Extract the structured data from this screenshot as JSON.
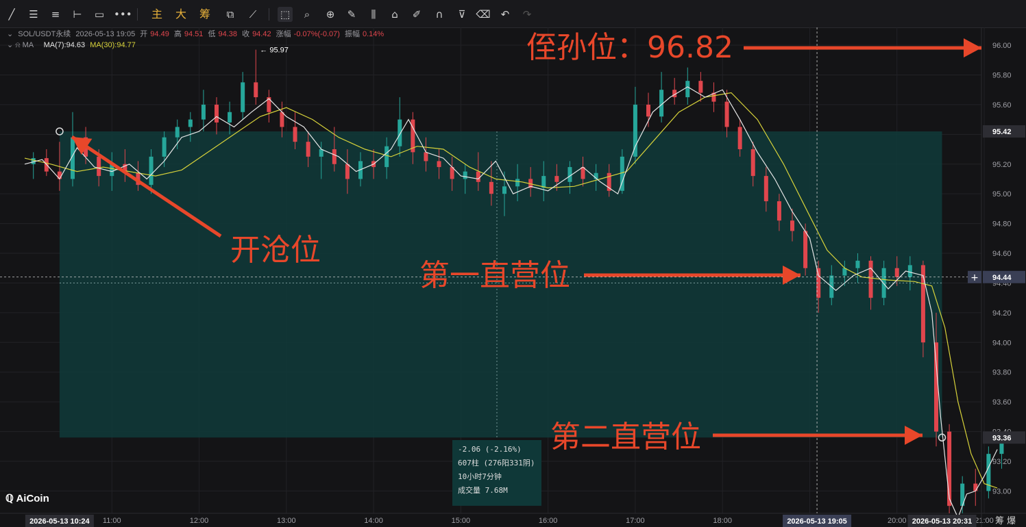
{
  "toolbar": {
    "icons": [
      "line-tool-icon",
      "horizontal-lines-icon",
      "parallel-lines-icon",
      "horizontal-ray-icon",
      "rectangle-icon",
      "more-shapes-icon"
    ],
    "labels": [
      "主",
      "大",
      "筹"
    ],
    "tools": [
      "crop-icon",
      "measure-icon",
      "zoom-icon",
      "brush-icon",
      "candle-icon",
      "lock-icon",
      "edit-icon",
      "magnet-icon",
      "filter-icon",
      "trash-icon",
      "undo-icon",
      "redo-icon"
    ]
  },
  "info": {
    "symbol": "SOL/USDT永续",
    "datetime": "2026-05-13 19:05",
    "open_label": "开",
    "open": "94.49",
    "high_label": "高",
    "high": "94.51",
    "low_label": "低",
    "low": "94.38",
    "close_label": "收",
    "close": "94.42",
    "change_label": "涨幅",
    "change": "-0.07%(-0.07)",
    "amp_label": "振幅",
    "amp": "0.14%"
  },
  "ma": {
    "name": "MA",
    "ma7": "MA(7):94.63",
    "ma30": "MA(30):94.77"
  },
  "tooltip": {
    "line1": "-2.06 (-2.16%)",
    "line2": "607柱 (276阳331阴)",
    "line3": "10小时7分钟",
    "line4": "成交量 7.68M"
  },
  "logo": "AiCoin",
  "bottom_right": "筹 爆",
  "colors": {
    "up": "#26a69a",
    "down": "#e0464d",
    "ma7": "#e6e6e6",
    "ma30": "#d7d23a",
    "zone": "#0f3a3a",
    "annotation": "#e8472a"
  },
  "chart_data": {
    "type": "candlestick",
    "y_ticks": [
      "96.00",
      "95.80",
      "95.60",
      "95.40",
      "95.20",
      "95.00",
      "94.80",
      "94.60",
      "94.40",
      "94.20",
      "94.00",
      "93.80",
      "93.60",
      "93.40",
      "93.20",
      "93.00"
    ],
    "x_ticks": [
      "11:00",
      "12:00",
      "13:00",
      "14:00",
      "15:00",
      "16:00",
      "17:00",
      "18:00",
      "19:00",
      "20:00",
      "21:00"
    ],
    "ylim": [
      92.85,
      96.12
    ],
    "xlim": [
      "10:00",
      "21:00"
    ],
    "price_badges": [
      "95.42",
      "94.44",
      "93.36"
    ],
    "x_badges": [
      "2026-05-13 10:24",
      "2026-05-13 19:05",
      "2026-05-13 20:31"
    ],
    "high_marker": "← 95.97",
    "zone": {
      "x_start": "10:24",
      "x_end": "20:31",
      "y_top": 95.42,
      "y_bottom": 93.36
    },
    "ma7_points": [
      [
        10.0,
        95.2
      ],
      [
        10.2,
        95.23
      ],
      [
        10.4,
        95.1
      ],
      [
        10.6,
        95.31
      ],
      [
        10.8,
        95.18
      ],
      [
        11.0,
        95.15
      ],
      [
        11.2,
        95.2
      ],
      [
        11.4,
        95.1
      ],
      [
        11.6,
        95.22
      ],
      [
        11.8,
        95.38
      ],
      [
        12.0,
        95.42
      ],
      [
        12.2,
        95.52
      ],
      [
        12.4,
        95.45
      ],
      [
        12.6,
        95.55
      ],
      [
        12.8,
        95.64
      ],
      [
        13.0,
        95.52
      ],
      [
        13.2,
        95.45
      ],
      [
        13.4,
        95.3
      ],
      [
        13.6,
        95.25
      ],
      [
        13.8,
        95.15
      ],
      [
        14.0,
        95.2
      ],
      [
        14.2,
        95.3
      ],
      [
        14.4,
        95.5
      ],
      [
        14.6,
        95.28
      ],
      [
        14.8,
        95.24
      ],
      [
        15.0,
        95.12
      ],
      [
        15.2,
        95.1
      ],
      [
        15.4,
        95.22
      ],
      [
        15.6,
        95.0
      ],
      [
        15.8,
        95.05
      ],
      [
        16.0,
        95.02
      ],
      [
        16.2,
        95.1
      ],
      [
        16.4,
        95.18
      ],
      [
        16.6,
        95.08
      ],
      [
        16.8,
        95.0
      ],
      [
        17.0,
        95.32
      ],
      [
        17.2,
        95.55
      ],
      [
        17.4,
        95.65
      ],
      [
        17.6,
        95.72
      ],
      [
        17.8,
        95.65
      ],
      [
        18.0,
        95.7
      ],
      [
        18.2,
        95.5
      ],
      [
        18.4,
        95.28
      ],
      [
        18.6,
        95.1
      ],
      [
        18.8,
        94.88
      ],
      [
        19.0,
        94.7
      ],
      [
        19.1,
        94.45
      ],
      [
        19.3,
        94.35
      ],
      [
        19.5,
        94.45
      ],
      [
        19.7,
        94.5
      ],
      [
        19.9,
        94.36
      ],
      [
        20.1,
        94.48
      ],
      [
        20.3,
        94.45
      ],
      [
        20.4,
        94.2
      ],
      [
        20.5,
        93.5
      ],
      [
        20.6,
        92.95
      ],
      [
        20.7,
        92.82
      ],
      [
        20.8,
        92.98
      ],
      [
        20.9,
        93.0
      ],
      [
        21.0,
        93.1
      ],
      [
        21.15,
        93.28
      ]
    ],
    "ma30_points": [
      [
        10.0,
        95.24
      ],
      [
        10.3,
        95.2
      ],
      [
        10.6,
        95.15
      ],
      [
        10.9,
        95.18
      ],
      [
        11.2,
        95.15
      ],
      [
        11.5,
        95.12
      ],
      [
        11.8,
        95.16
      ],
      [
        12.1,
        95.28
      ],
      [
        12.4,
        95.4
      ],
      [
        12.7,
        95.52
      ],
      [
        13.0,
        95.58
      ],
      [
        13.3,
        95.5
      ],
      [
        13.6,
        95.38
      ],
      [
        13.9,
        95.3
      ],
      [
        14.2,
        95.25
      ],
      [
        14.5,
        95.32
      ],
      [
        14.8,
        95.3
      ],
      [
        15.1,
        95.18
      ],
      [
        15.4,
        95.1
      ],
      [
        15.7,
        95.08
      ],
      [
        16.0,
        95.04
      ],
      [
        16.3,
        95.05
      ],
      [
        16.6,
        95.1
      ],
      [
        16.9,
        95.15
      ],
      [
        17.2,
        95.35
      ],
      [
        17.5,
        95.55
      ],
      [
        17.8,
        95.65
      ],
      [
        18.1,
        95.68
      ],
      [
        18.4,
        95.5
      ],
      [
        18.7,
        95.2
      ],
      [
        19.0,
        94.85
      ],
      [
        19.2,
        94.62
      ],
      [
        19.4,
        94.5
      ],
      [
        19.6,
        94.44
      ],
      [
        19.9,
        94.42
      ],
      [
        20.2,
        94.41
      ],
      [
        20.4,
        94.38
      ],
      [
        20.55,
        94.1
      ],
      [
        20.7,
        93.6
      ],
      [
        20.85,
        93.25
      ],
      [
        21.0,
        93.05
      ],
      [
        21.15,
        93.02
      ]
    ],
    "candles": [
      [
        10.1,
        95.2,
        95.28,
        95.1,
        95.24
      ],
      [
        10.25,
        95.24,
        95.3,
        95.12,
        95.15
      ],
      [
        10.4,
        95.15,
        95.35,
        95.02,
        95.1
      ],
      [
        10.55,
        95.1,
        95.55,
        95.05,
        95.38
      ],
      [
        10.7,
        95.38,
        95.45,
        95.2,
        95.25
      ],
      [
        10.85,
        95.25,
        95.3,
        95.05,
        95.12
      ],
      [
        11.0,
        95.12,
        95.28,
        95.02,
        95.2
      ],
      [
        11.15,
        95.2,
        95.3,
        95.08,
        95.14
      ],
      [
        11.3,
        95.14,
        95.22,
        95.02,
        95.06
      ],
      [
        11.45,
        95.06,
        95.3,
        95.0,
        95.25
      ],
      [
        11.6,
        95.25,
        95.42,
        95.18,
        95.38
      ],
      [
        11.75,
        95.38,
        95.5,
        95.3,
        95.45
      ],
      [
        11.9,
        95.45,
        95.55,
        95.35,
        95.5
      ],
      [
        12.05,
        95.5,
        95.7,
        95.42,
        95.6
      ],
      [
        12.2,
        95.6,
        95.65,
        95.4,
        95.48
      ],
      [
        12.35,
        95.48,
        95.62,
        95.4,
        95.55
      ],
      [
        12.5,
        95.55,
        95.82,
        95.5,
        95.75
      ],
      [
        12.65,
        95.75,
        95.97,
        95.6,
        95.65
      ],
      [
        12.8,
        95.65,
        95.7,
        95.48,
        95.55
      ],
      [
        12.95,
        95.55,
        95.62,
        95.38,
        95.45
      ],
      [
        13.1,
        95.45,
        95.55,
        95.3,
        95.35
      ],
      [
        13.25,
        95.35,
        95.42,
        95.18,
        95.25
      ],
      [
        13.4,
        95.25,
        95.35,
        95.1,
        95.3
      ],
      [
        13.55,
        95.3,
        95.45,
        95.15,
        95.2
      ],
      [
        13.7,
        95.2,
        95.3,
        95.0,
        95.1
      ],
      [
        13.85,
        95.1,
        95.28,
        95.05,
        95.22
      ],
      [
        14.0,
        95.22,
        95.3,
        95.1,
        95.18
      ],
      [
        14.15,
        95.18,
        95.38,
        95.1,
        95.32
      ],
      [
        14.3,
        95.32,
        95.65,
        95.25,
        95.5
      ],
      [
        14.45,
        95.5,
        95.55,
        95.2,
        95.28
      ],
      [
        14.6,
        95.28,
        95.38,
        95.15,
        95.22
      ],
      [
        14.75,
        95.22,
        95.3,
        95.1,
        95.18
      ],
      [
        14.9,
        95.18,
        95.25,
        95.02,
        95.1
      ],
      [
        15.05,
        95.1,
        95.2,
        95.0,
        95.15
      ],
      [
        15.2,
        95.15,
        95.28,
        95.02,
        95.08
      ],
      [
        15.35,
        95.08,
        95.22,
        94.92,
        95.0
      ],
      [
        15.5,
        95.0,
        95.15,
        94.85,
        95.05
      ],
      [
        15.65,
        95.05,
        95.2,
        94.95,
        95.1
      ],
      [
        15.8,
        95.1,
        95.18,
        94.98,
        95.04
      ],
      [
        15.95,
        95.04,
        95.22,
        94.95,
        95.12
      ],
      [
        16.1,
        95.12,
        95.2,
        95.02,
        95.08
      ],
      [
        16.25,
        95.08,
        95.22,
        95.0,
        95.18
      ],
      [
        16.4,
        95.18,
        95.25,
        95.05,
        95.1
      ],
      [
        16.55,
        95.1,
        95.2,
        95.02,
        95.14
      ],
      [
        16.7,
        95.14,
        95.2,
        94.98,
        95.02
      ],
      [
        16.85,
        95.02,
        95.3,
        95.0,
        95.25
      ],
      [
        17.0,
        95.25,
        95.72,
        95.2,
        95.6
      ],
      [
        17.15,
        95.6,
        95.68,
        95.45,
        95.52
      ],
      [
        17.3,
        95.52,
        95.82,
        95.48,
        95.7
      ],
      [
        17.45,
        95.7,
        95.78,
        95.6,
        95.65
      ],
      [
        17.6,
        95.65,
        95.85,
        95.6,
        95.76
      ],
      [
        17.75,
        95.76,
        95.82,
        95.62,
        95.68
      ],
      [
        17.9,
        95.68,
        95.75,
        95.55,
        95.62
      ],
      [
        18.05,
        95.62,
        95.7,
        95.38,
        95.45
      ],
      [
        18.2,
        95.45,
        95.5,
        95.25,
        95.3
      ],
      [
        18.35,
        95.3,
        95.35,
        95.05,
        95.12
      ],
      [
        18.5,
        95.12,
        95.18,
        94.88,
        94.95
      ],
      [
        18.65,
        94.95,
        95.0,
        94.75,
        94.82
      ],
      [
        18.8,
        94.82,
        94.9,
        94.68,
        94.75
      ],
      [
        18.95,
        94.75,
        94.8,
        94.45,
        94.5
      ],
      [
        19.1,
        94.5,
        94.55,
        94.2,
        94.3
      ],
      [
        19.25,
        94.3,
        94.52,
        94.25,
        94.45
      ],
      [
        19.4,
        94.45,
        94.55,
        94.38,
        94.5
      ],
      [
        19.55,
        94.5,
        94.6,
        94.4,
        94.55
      ],
      [
        19.7,
        94.55,
        94.58,
        94.22,
        94.3
      ],
      [
        19.85,
        94.3,
        94.55,
        94.25,
        94.5
      ],
      [
        20.0,
        94.5,
        94.58,
        94.38,
        94.44
      ],
      [
        20.15,
        94.44,
        94.58,
        94.35,
        94.52
      ],
      [
        20.3,
        94.52,
        94.55,
        93.9,
        94.0
      ],
      [
        20.45,
        94.0,
        94.2,
        93.3,
        93.4
      ],
      [
        20.6,
        93.4,
        93.45,
        92.85,
        92.9
      ],
      [
        20.75,
        92.9,
        93.1,
        92.85,
        93.05
      ],
      [
        20.9,
        93.05,
        93.15,
        92.9,
        93.0
      ],
      [
        21.05,
        93.0,
        93.3,
        92.95,
        93.25
      ],
      [
        21.2,
        93.25,
        93.38,
        93.15,
        93.32
      ]
    ]
  },
  "annotations": {
    "stop_loss": "侄孙位：96.82",
    "open_position": "开沧位",
    "tp1": "第一直营位",
    "tp2": "第二直营位"
  }
}
